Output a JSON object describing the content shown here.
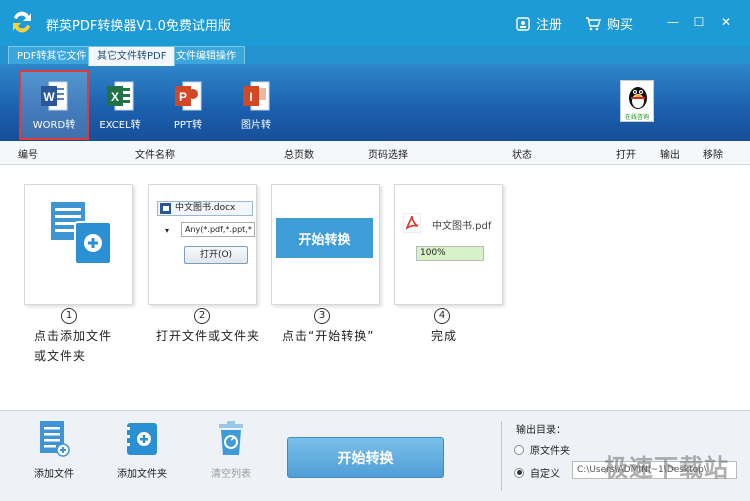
{
  "titlebar": {
    "title": "群英PDF转换器V1.0免费试用版",
    "register": "注册",
    "buy": "购买",
    "minimize": "—",
    "maximize": "☐",
    "close": "✕"
  },
  "tabs": [
    {
      "label": "PDF转其它文件",
      "active": false
    },
    {
      "label": "其它文件转PDF",
      "active": true
    },
    {
      "label": "文件编辑操作",
      "active": false
    }
  ],
  "toolbar": {
    "items": [
      {
        "label": "WORD转",
        "icon": "word-icon",
        "letter": "W",
        "color": "#2b579a"
      },
      {
        "label": "EXCEL转",
        "icon": "excel-icon",
        "letter": "X",
        "color": "#217346"
      },
      {
        "label": "PPT转",
        "icon": "powerpoint-icon",
        "letter": "P",
        "color": "#d24726"
      },
      {
        "label": "图片转",
        "icon": "image-icon",
        "letter": "I",
        "color": "#d24726"
      }
    ],
    "qq_label": "在线咨询"
  },
  "list_header": {
    "columns": [
      "编号",
      "文件名称",
      "总页数",
      "页码选择",
      "状态",
      "打开",
      "输出",
      "移除"
    ]
  },
  "steps": [
    {
      "num": "1",
      "line1": "点击添加文件",
      "line2": "或文件夹"
    },
    {
      "num": "2",
      "line1": "打开文件或文件夹",
      "line2": "",
      "file": "中文图书.docx",
      "filter": "Any(*.pdf,*.ppt,*",
      "open": "打开(O)"
    },
    {
      "num": "3",
      "line1": "点击“开始转换”",
      "line2": "",
      "button": "开始转换"
    },
    {
      "num": "4",
      "line1": "完成",
      "line2": "",
      "file": "中文图书.pdf",
      "progress": "100%"
    }
  ],
  "bottom": {
    "add_file": "添加文件",
    "add_folder": "添加文件夹",
    "clear_list": "清空列表",
    "start": "开始转换",
    "output_label": "输出目录：",
    "option_original": "原文件夹",
    "option_custom": "自定义",
    "custom_path": "C:\\Users\\ADMINI~1\\Desktop\\"
  },
  "watermark": "极速下载站",
  "colors": {
    "accent": "#1d9bd6",
    "selected_border": "#e0393a"
  }
}
